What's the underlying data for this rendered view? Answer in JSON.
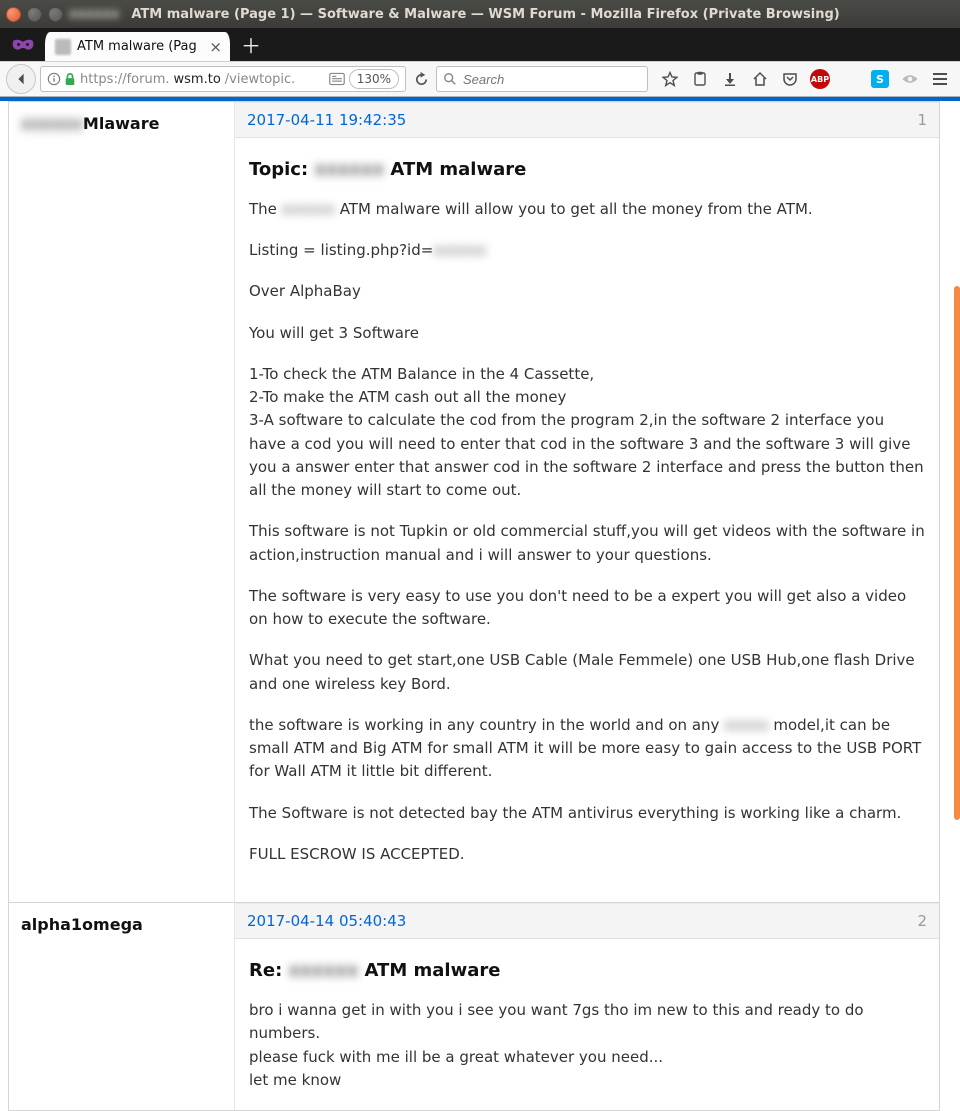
{
  "window": {
    "title_prefix_blur": "xxxxxx",
    "title": "ATM malware (Page 1) — Software & Malware — WSM Forum - Mozilla Firefox (Private Browsing)"
  },
  "tab": {
    "title": "ATM malware (Pag"
  },
  "navbar": {
    "url_prefix": "https://forum.",
    "url_host": "wsm.to",
    "url_path": "/viewtopic.",
    "zoom": "130%",
    "search_placeholder": "Search"
  },
  "toolbar_badges": {
    "abp": "ABP",
    "skype": "S"
  },
  "posts": [
    {
      "author_blur": "xxxxxx",
      "author_suffix": "Mlaware",
      "timestamp": "2017-04-11 19:42:35",
      "number": "1",
      "topic_label": "Topic:",
      "topic_blur": "xxxxxx",
      "topic_suffix": " ATM malware",
      "p1_a": "The ",
      "p1_blur": "xxxxxx",
      "p1_b": " ATM malware will allow you to get all the money from the ATM.",
      "p2_a": "Listing = listing.php?id=",
      "p2_blur": "xxxxxx",
      "p3": "Over AlphaBay",
      "p4": "You will get 3 Software",
      "l1": "1-To check the ATM Balance in the 4 Cassette,",
      "l2": "2-To make the ATM cash out all the money",
      "l3": "3-A software to calculate the cod from the program 2,in the software 2 interface you have a cod you will need to enter that cod in the software 3 and the software 3 will give you a answer enter that answer cod in the software 2 interface and press the button then all the money will start to come out.",
      "p5": "This software is not Tupkin or old commercial stuff,you will get videos with the software in action,instruction manual and i will answer to your questions.",
      "p6": "The software is very easy to use you don't need to be a expert you will get also a video on how to execute the software.",
      "p7": "What you need to get start,one USB Cable (Male Femmele) one USB Hub,one flash Drive and one wireless key Bord.",
      "p8_a": "the software is working in any country in the world and on any ",
      "p8_blur": "xxxxx",
      "p8_b": " model,it can be small ATM and Big ATM for small ATM it will be more easy to gain access to the USB PORT for Wall ATM it little bit different.",
      "p9": "The Software is not detected bay the ATM antivirus everything is working like a charm.",
      "p10": "FULL ESCROW IS ACCEPTED."
    },
    {
      "author": "alpha1omega",
      "timestamp": "2017-04-14 05:40:43",
      "number": "2",
      "topic_label": "Re:",
      "topic_blur": "xxxxxx",
      "topic_suffix": " ATM malware",
      "r1": "bro i wanna get in with you i see you want 7gs tho im new to this and ready to do numbers.",
      "r2": "please fuck with me ill be a great whatever you need...",
      "r3": "let me know"
    }
  ]
}
